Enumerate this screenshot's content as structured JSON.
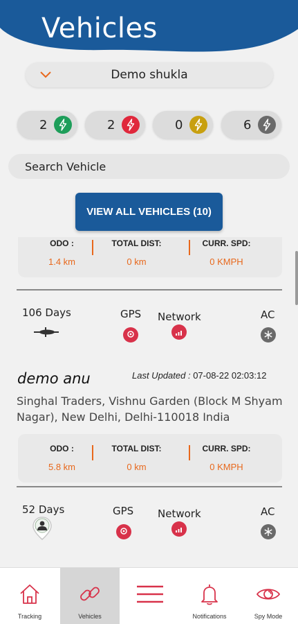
{
  "header": {
    "title": "Vehicles"
  },
  "account": {
    "name": "Demo shukla",
    "icon": "chevron-down-icon"
  },
  "status_filters": [
    {
      "count": "2",
      "color": "#1e9e5a",
      "icon": "bolt-icon"
    },
    {
      "count": "2",
      "color": "#e0283c",
      "icon": "bolt-icon"
    },
    {
      "count": "0",
      "color": "#c8a010",
      "icon": "bolt-icon"
    },
    {
      "count": "6",
      "color": "#6a6a6a",
      "icon": "bolt-icon"
    }
  ],
  "search": {
    "placeholder": "Search Vehicle"
  },
  "view_all": {
    "label": "VIEW ALL VEHICLES (10)"
  },
  "vehicles": [
    {
      "stats": {
        "odo_label": "ODO :",
        "odo": "1.4 km",
        "dist_label": "TOTAL DIST:",
        "dist": "0 km",
        "speed_label": "CURR. SPD:",
        "speed": "0 KMPH"
      },
      "days": "106 Days",
      "vehicle_icon": "bike-icon",
      "gps_label": "GPS",
      "network_label": "Network",
      "ac_label": "AC"
    },
    {
      "name": "demo anu",
      "last_updated_label": "Last Updated :",
      "last_updated": "07-08-22 02:03:12",
      "address": "Singhal Traders, Vishnu Garden (Block M Shyam Nagar), New Delhi, Delhi-110018 India",
      "stats": {
        "odo_label": "ODO :",
        "odo": "5.8 km",
        "dist_label": "TOTAL DIST:",
        "dist": "0 km",
        "speed_label": "CURR. SPD:",
        "speed": "0 KMPH"
      },
      "days": "52 Days",
      "vehicle_icon": "person-icon",
      "gps_label": "GPS",
      "network_label": "Network",
      "ac_label": "AC"
    }
  ],
  "colors": {
    "brand_blue": "#1a5a9a",
    "accent_red": "#d8324a",
    "accent_orange": "#e8681c"
  },
  "bottom_nav": [
    {
      "label": "Tracking",
      "icon": "home-icon"
    },
    {
      "label": "Vehicles",
      "icon": "link-icon",
      "active": true
    },
    {
      "label": "",
      "icon": "menu-icon"
    },
    {
      "label": "Notifications",
      "icon": "bell-icon"
    },
    {
      "label": "Spy Mode",
      "icon": "eye-icon"
    }
  ]
}
